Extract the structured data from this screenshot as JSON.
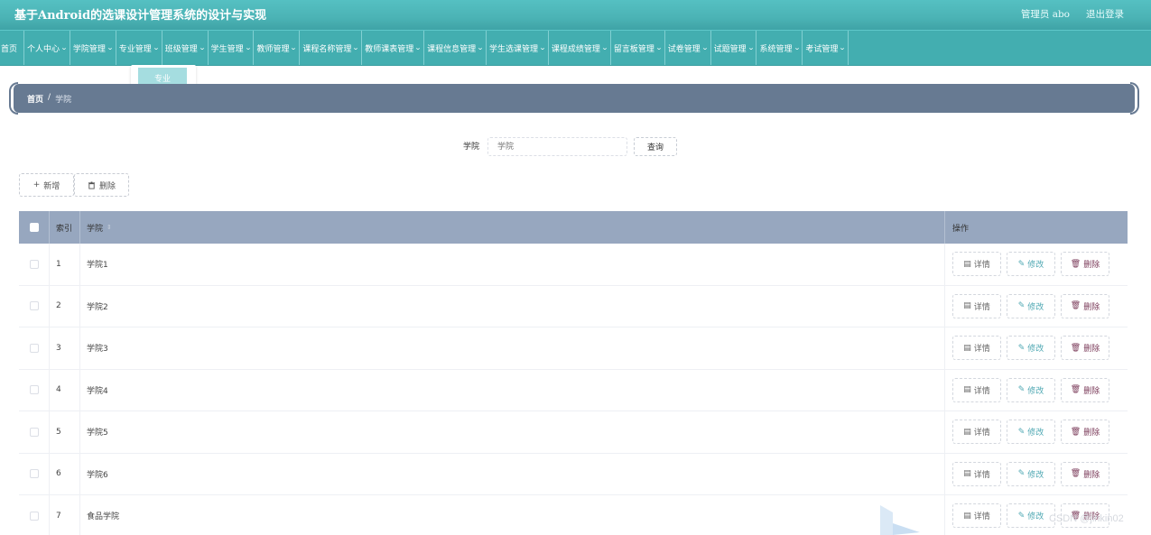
{
  "header": {
    "title": "基于Android的选课设计管理系统的设计与实现",
    "user": "管理员 abo",
    "logout": "退出登录"
  },
  "nav": {
    "items": [
      "首页",
      "个人中心",
      "学院管理",
      "专业管理",
      "班级管理",
      "学生管理",
      "教师管理",
      "课程名称管理",
      "教师课表管理",
      "课程信息管理",
      "学生选课管理",
      "课程成绩管理",
      "留言板管理",
      "试卷管理",
      "试题管理",
      "系统管理",
      "考试管理"
    ],
    "chevron_icon": "chevron-down-icon"
  },
  "dropdown": {
    "item": "专业"
  },
  "breadcrumb": {
    "home": "首页",
    "separator": "/",
    "current": "学院"
  },
  "search": {
    "label": "学院",
    "placeholder": "学院",
    "button": "查询"
  },
  "actions": {
    "add": "新增",
    "delete": "删除"
  },
  "table": {
    "headers": {
      "index": "索引",
      "name": "学院",
      "ops": "操作"
    },
    "rows": [
      {
        "index": "1",
        "name": "学院1"
      },
      {
        "index": "2",
        "name": "学院2"
      },
      {
        "index": "3",
        "name": "学院3"
      },
      {
        "index": "4",
        "name": "学院4"
      },
      {
        "index": "5",
        "name": "学院5"
      },
      {
        "index": "6",
        "name": "学院6"
      },
      {
        "index": "7",
        "name": "食品学院"
      }
    ],
    "ops": {
      "detail": "详情",
      "edit": "修改",
      "remove": "删除"
    }
  },
  "watermark": "CSDN @jinkin02",
  "colors": {
    "header": "#4bb3b5",
    "nav": "#43aeb0",
    "breadcrumb": "#677a92",
    "table_head": "#97a7bf"
  }
}
